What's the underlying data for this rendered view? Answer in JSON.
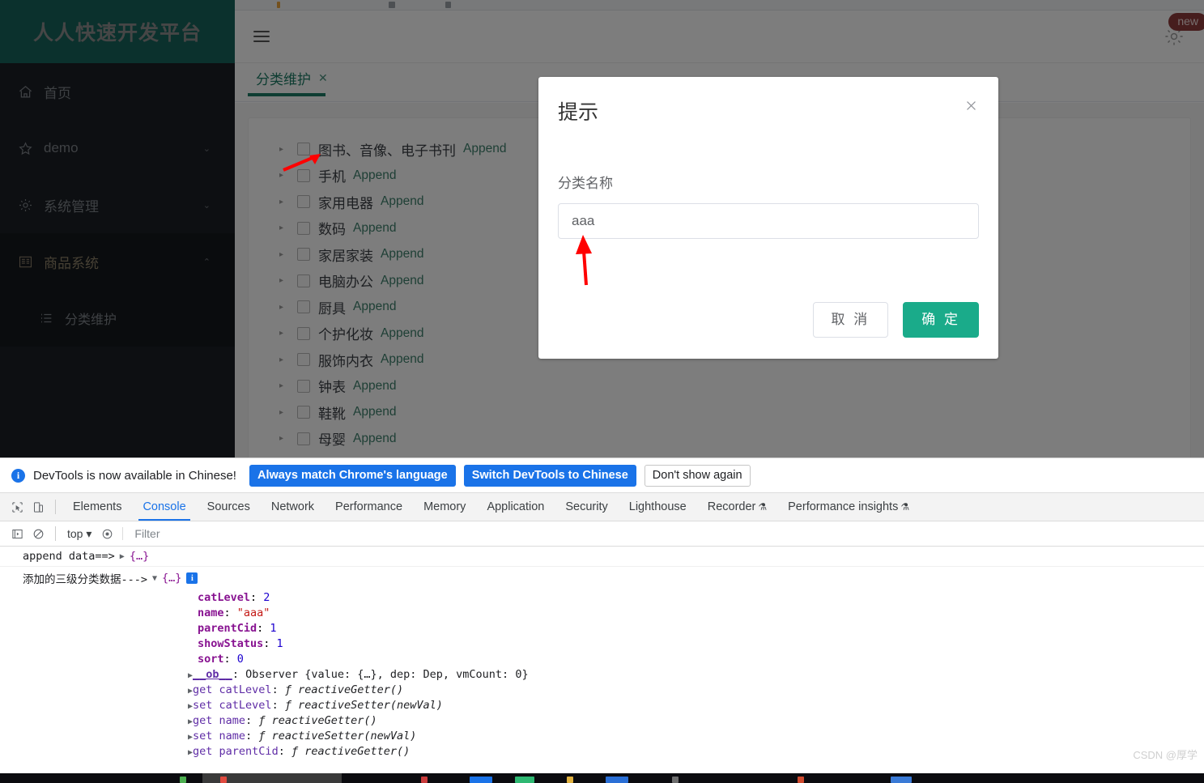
{
  "app": {
    "brand": "人人快速开发平台",
    "sidebar": {
      "items": [
        {
          "label": "首页",
          "icon": "home-icon",
          "arrow": ""
        },
        {
          "label": "demo",
          "icon": "star-icon",
          "arrow": "⌄"
        },
        {
          "label": "系统管理",
          "icon": "gear-icon",
          "arrow": "⌄"
        },
        {
          "label": "商品系统",
          "icon": "catalog-icon",
          "arrow": "⌃"
        }
      ],
      "sub_items": [
        {
          "label": "分类维护",
          "icon": "list-icon"
        }
      ]
    },
    "topbar": {
      "menu_icon": "hamburger-icon",
      "settings_icon": "gear-icon",
      "new_badge": "new"
    },
    "tabs": [
      {
        "label": "分类维护",
        "close": "✕"
      }
    ],
    "tree": [
      {
        "name": "图书、音像、电子书刊",
        "append": "Append"
      },
      {
        "name": "手机",
        "append": "Append"
      },
      {
        "name": "家用电器",
        "append": "Append"
      },
      {
        "name": "数码",
        "append": "Append"
      },
      {
        "name": "家居家装",
        "append": "Append"
      },
      {
        "name": "电脑办公",
        "append": "Append"
      },
      {
        "name": "厨具",
        "append": "Append"
      },
      {
        "name": "个护化妆",
        "append": "Append"
      },
      {
        "name": "服饰内衣",
        "append": "Append"
      },
      {
        "name": "钟表",
        "append": "Append"
      },
      {
        "name": "鞋靴",
        "append": "Append"
      },
      {
        "name": "母婴",
        "append": "Append"
      }
    ],
    "colors": {
      "brand_teal": "#16625a",
      "confirm_green": "#1aab8a",
      "tab_green": "#1d7a64",
      "append_green": "#3c7e6b",
      "sidebar_dark": "#1b1f24",
      "badge_red": "#8d3a3a"
    }
  },
  "dialog": {
    "title": "提示",
    "close_icon": "close-icon",
    "field_label": "分类名称",
    "input_value": "aaa",
    "input_placeholder": "",
    "cancel_label": "取 消",
    "confirm_label": "确 定"
  },
  "devtools": {
    "banner": {
      "message": "DevTools is now available in Chinese!",
      "primary_button": "Always match Chrome's language",
      "secondary_button": "Switch DevTools to Chinese",
      "dismiss_button": "Don't show again"
    },
    "tabs": [
      {
        "label": "Elements",
        "selected": false,
        "flask": ""
      },
      {
        "label": "Console",
        "selected": true,
        "flask": ""
      },
      {
        "label": "Sources",
        "selected": false,
        "flask": ""
      },
      {
        "label": "Network",
        "selected": false,
        "flask": ""
      },
      {
        "label": "Performance",
        "selected": false,
        "flask": ""
      },
      {
        "label": "Memory",
        "selected": false,
        "flask": ""
      },
      {
        "label": "Application",
        "selected": false,
        "flask": ""
      },
      {
        "label": "Security",
        "selected": false,
        "flask": ""
      },
      {
        "label": "Lighthouse",
        "selected": false,
        "flask": ""
      },
      {
        "label": "Recorder",
        "selected": false,
        "flask": "⚗"
      },
      {
        "label": "Performance insights",
        "selected": false,
        "flask": "⚗"
      }
    ],
    "filterbar": {
      "context": "top",
      "context_caret": "▾",
      "filter_placeholder": "Filter"
    },
    "console": {
      "line1": {
        "text": "append data==>",
        "caret": "▶",
        "obj": "{…}"
      },
      "line2": {
        "text": "添加的三级分类数据--->",
        "caret": "▼",
        "obj": "{…}",
        "badge": "i"
      },
      "props": [
        {
          "key": "catLevel",
          "value": "2",
          "type": "number"
        },
        {
          "key": "name",
          "value": "\"aaa\"",
          "type": "string"
        },
        {
          "key": "parentCid",
          "value": "1",
          "type": "number"
        },
        {
          "key": "showStatus",
          "value": "1",
          "type": "number"
        },
        {
          "key": "sort",
          "value": "0",
          "type": "number"
        }
      ],
      "accessors": [
        {
          "caret": "▶",
          "key": "__ob__",
          "underline": true,
          "sep": ": ",
          "val": "Observer {value: {…}, dep: Dep, vmCount: 0}",
          "italic": false
        },
        {
          "caret": "▶",
          "key": "get catLevel",
          "underline": false,
          "sep": ": ",
          "val": "ƒ reactiveGetter()",
          "italic": true
        },
        {
          "caret": "▶",
          "key": "set catLevel",
          "underline": false,
          "sep": ": ",
          "val": "ƒ reactiveSetter(newVal)",
          "italic": true
        },
        {
          "caret": "▶",
          "key": "get name",
          "underline": false,
          "sep": ": ",
          "val": "ƒ reactiveGetter()",
          "italic": true
        },
        {
          "caret": "▶",
          "key": "set name",
          "underline": false,
          "sep": ": ",
          "val": "ƒ reactiveSetter(newVal)",
          "italic": true
        },
        {
          "caret": "▶",
          "key": "get parentCid",
          "underline": false,
          "sep": ": ",
          "val": "ƒ reactiveGetter()",
          "italic": true
        }
      ]
    },
    "watermark": "CSDN @厚学"
  }
}
